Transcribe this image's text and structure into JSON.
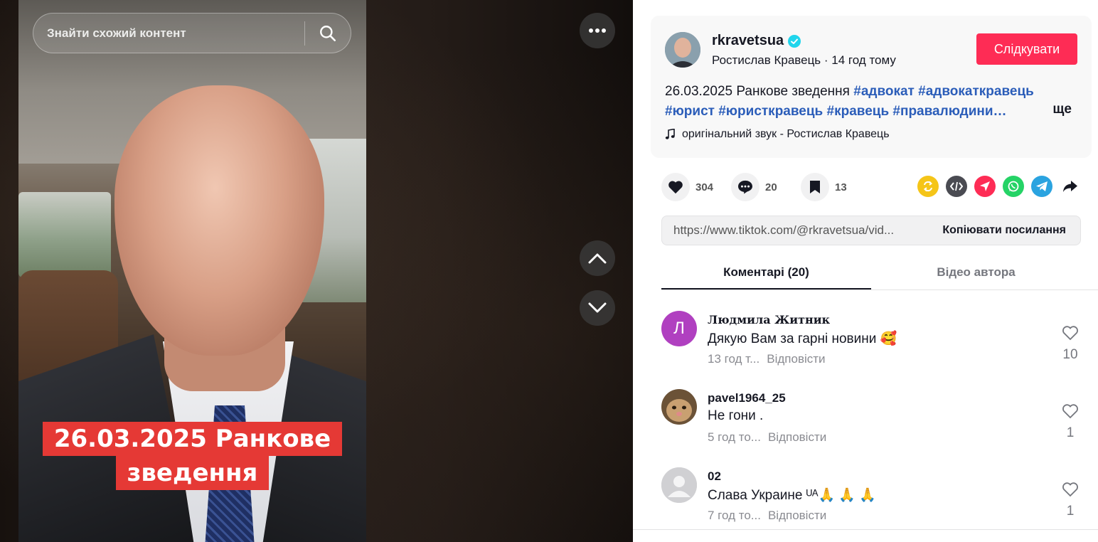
{
  "search": {
    "placeholder": "Знайти схожий контент"
  },
  "video": {
    "caption_line1": "26.03.2025 Ранкове",
    "caption_line2": "зведення"
  },
  "author": {
    "username": "rkravetsua",
    "display_name": "Ростислав Кравець",
    "posted": "14 год тому",
    "meta": "Ростислав Кравець · 14 год тому",
    "follow_label": "Слідкувати",
    "verified": true
  },
  "description": {
    "date_text": "26.03.2025 Ранкове зведення",
    "tags": [
      "#адвокат",
      "#адвокаткравець",
      "#юрист",
      "#юристкравець",
      "#кравець",
      "#правалюдини…"
    ],
    "more_label": "ще"
  },
  "sound": {
    "label": "оригінальний звук - Ростислав Кравець",
    "icon": "music-note-icon"
  },
  "stats": {
    "likes": "304",
    "comments": "20",
    "saves": "13"
  },
  "share_icons": [
    {
      "name": "repost-icon",
      "color": "#f5c518"
    },
    {
      "name": "embed-icon",
      "color": "#4a4b52"
    },
    {
      "name": "send-icon",
      "color": "#fe2c55"
    },
    {
      "name": "whatsapp-icon",
      "color": "#25d366"
    },
    {
      "name": "telegram-icon",
      "color": "#2aa3e0"
    },
    {
      "name": "share-arrow-icon",
      "color": "#161823"
    }
  ],
  "link": {
    "url": "https://www.tiktok.com/@rkravetsua/vid...",
    "copy_label": "Копіювати посилання"
  },
  "tabs": [
    {
      "label": "Коментарі (20)",
      "active": true
    },
    {
      "label": "Відео автора",
      "active": false
    }
  ],
  "comments": [
    {
      "avatar_letter": "Л",
      "avatar_color": "#b040c0",
      "name": "Людмила Житник",
      "text": "Дякую Вам за гарні новини 🥰",
      "time": "13 год т...",
      "reply": "Відповісти",
      "likes": "10"
    },
    {
      "avatar_letter": "",
      "avatar_color": "#8a6a45",
      "name": "pavel1964_25",
      "text": "Не гони .",
      "time": "5 год то...",
      "reply": "Відповісти",
      "likes": "1"
    },
    {
      "avatar_letter": "",
      "avatar_color": "#d0d0d3",
      "name": "02",
      "text": "Слава Украине ᵁᴬ🙏 🙏 🙏",
      "time": "7 год то...",
      "reply": "Відповісти",
      "likes": "1"
    }
  ]
}
